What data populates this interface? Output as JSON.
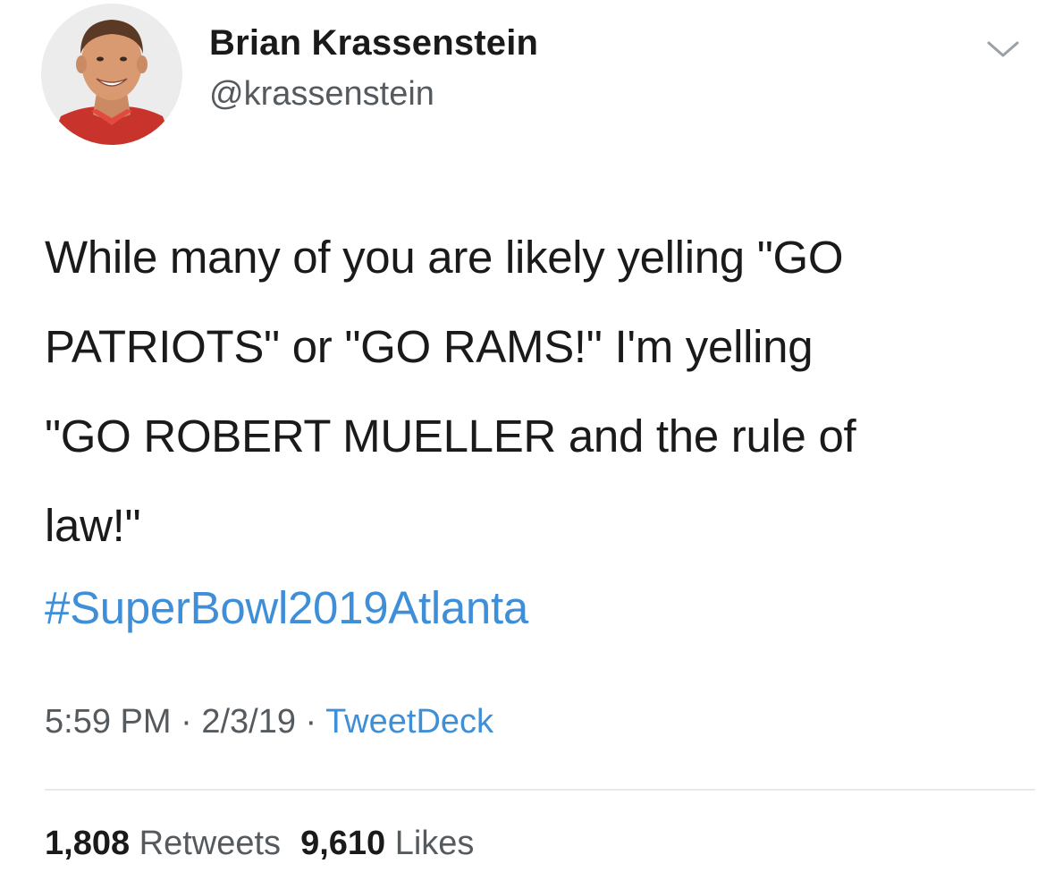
{
  "author": {
    "name": "Brian Krassenstein",
    "handle": "@krassenstein",
    "avatar_icon": "profile-photo"
  },
  "menu": {
    "icon": "chevron-down-icon"
  },
  "tweet": {
    "lines": [
      "While many of you are likely yelling \"GO",
      "PATRIOTS\" or \"GO RAMS!\" I'm yelling",
      "\"GO ROBERT MUELLER and the rule of",
      "law!\""
    ],
    "hashtag": "#SuperBowl2019Atlanta"
  },
  "meta": {
    "time": "5:59 PM",
    "separator": " · ",
    "date": "2/3/19",
    "source": "TweetDeck"
  },
  "stats": {
    "retweets_count": "1,808",
    "retweets_label": "Retweets",
    "likes_count": "9,610",
    "likes_label": "Likes"
  },
  "colors": {
    "link": "#3f8fd8",
    "secondary_text": "#555a5f",
    "primary_text": "#1a1a1a",
    "divider": "#e6e8ea"
  }
}
